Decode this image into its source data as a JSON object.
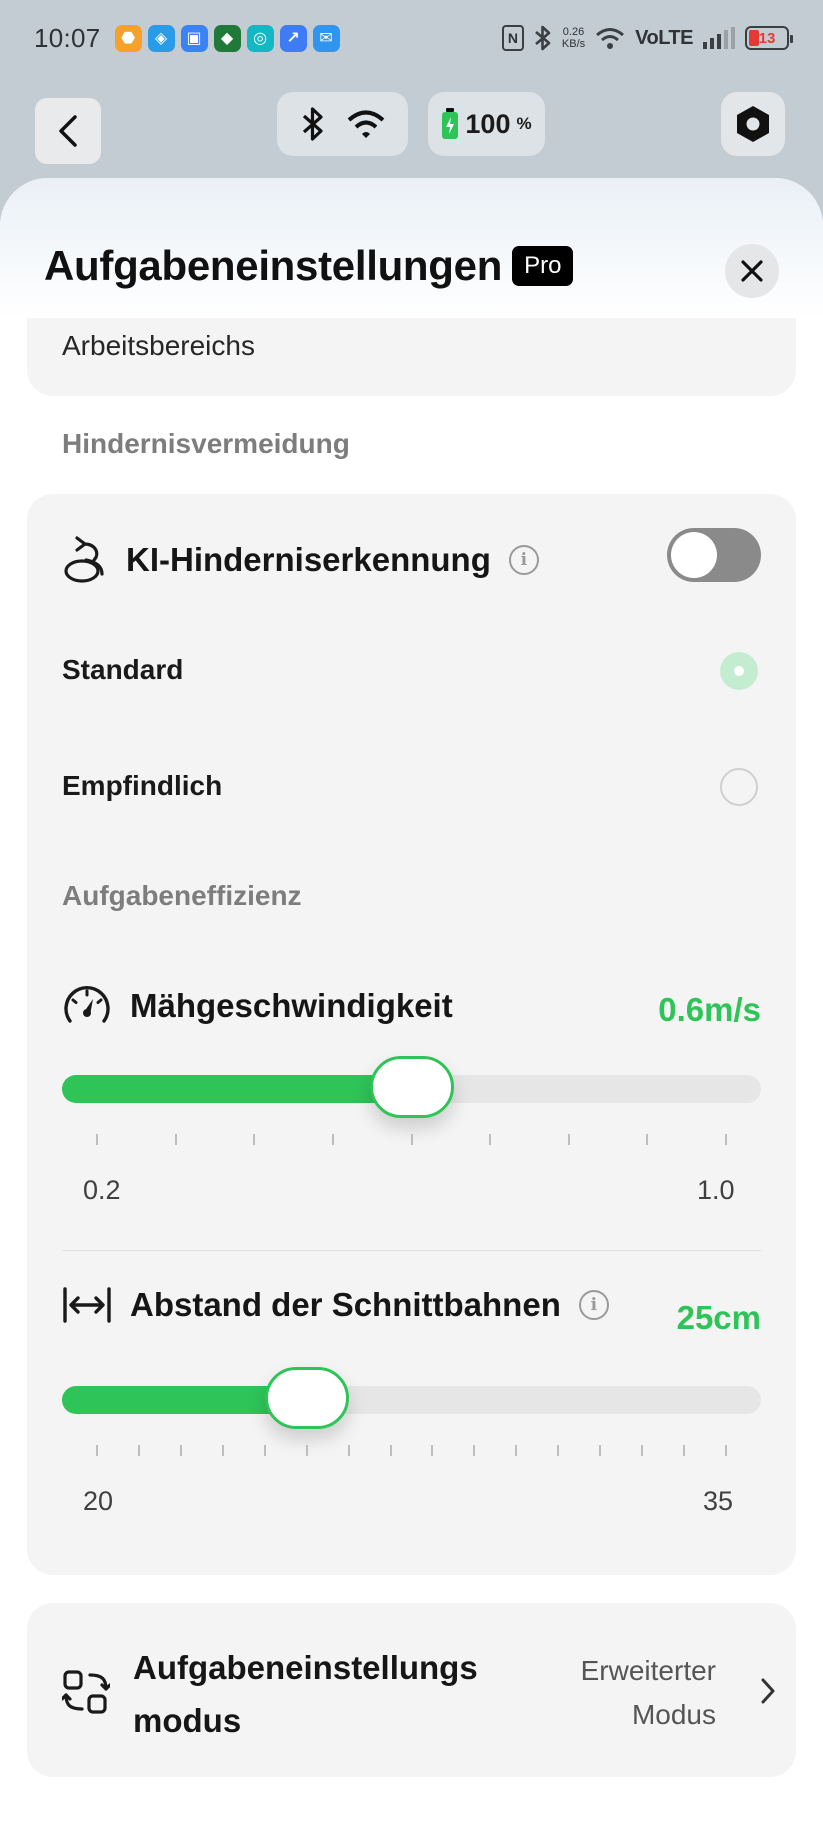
{
  "status_bar": {
    "time": "10:07",
    "speed_value": "0.26",
    "speed_unit": "KB/s",
    "network": "VoLTE",
    "battery": "13"
  },
  "device_bar": {
    "battery_level": "100",
    "battery_unit": "%"
  },
  "sheet": {
    "title": "Aufgabeneinstellungen",
    "badge": "Pro",
    "top_item": "Arbeitsbereichs",
    "obstacle": {
      "section": "Hindernisvermeidung",
      "ai_label": "KI-Hinderniserkennung",
      "ai_enabled": false,
      "options": [
        {
          "label": "Standard",
          "selected": true
        },
        {
          "label": "Empfindlich",
          "selected": false
        }
      ]
    },
    "efficiency": {
      "section": "Aufgabeneffizienz",
      "speed": {
        "label": "Mähgeschwindigkeit",
        "value_text": "0.6m/s",
        "min_label": "0.2",
        "max_label": "1.0",
        "min": 0.2,
        "max": 1.0,
        "value": 0.6,
        "ticks": 9
      },
      "spacing": {
        "label": "Abstand der Schnittbahnen",
        "value_text": "25cm",
        "min_label": "20",
        "max_label": "35",
        "min": 20,
        "max": 35,
        "value": 25,
        "ticks": 16
      }
    },
    "mode": {
      "label_line1": "Aufgabeneinstellungs",
      "label_line2": "modus",
      "value_line1": "Erweiterter",
      "value_line2": "Modus"
    }
  },
  "colors": {
    "accent": "#2ec458",
    "card_bg": "#f4f4f4",
    "section_label": "#7d7d7d"
  }
}
